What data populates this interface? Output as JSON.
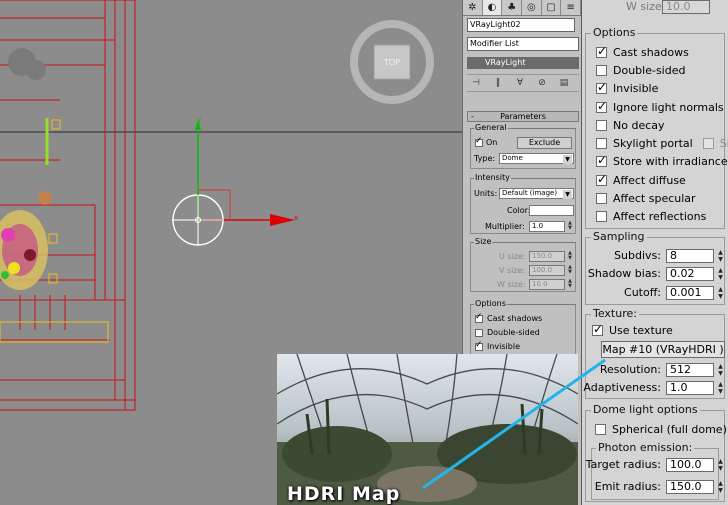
{
  "viewport": {
    "label": "TOP",
    "axis_x": "x",
    "axis_y": "y",
    "colors": {
      "bg": "#8c8c8c",
      "wire": "#cc1111",
      "selected": "#ffffff",
      "plant": "#d8c020"
    }
  },
  "command_panel": {
    "tabs": [
      "create-icon",
      "modify-icon",
      "hierarchy-icon",
      "motion-icon",
      "display-icon",
      "utilities-icon"
    ],
    "object_name": "VRayLight02",
    "modifier_list": "Modifier List",
    "stack_item": "VRayLight",
    "parameters_title": "Parameters",
    "general": {
      "label": "General",
      "on_label": "On",
      "on_checked": true,
      "exclude_button": "Exclude",
      "type_label": "Type:",
      "type_value": "Dome"
    },
    "intensity": {
      "label": "Intensity",
      "units_label": "Units:",
      "units_value": "Default (image)",
      "color_label": "Color:",
      "multiplier_label": "Multiplier:",
      "multiplier_value": "1.0"
    },
    "size": {
      "label": "Size",
      "u_label": "U size:",
      "u_value": "150.0",
      "v_label": "V size:",
      "v_value": "100.0",
      "w_label": "W size:",
      "w_value": "10.0"
    },
    "options": {
      "label": "Options",
      "items": [
        {
          "label": "Cast shadows",
          "checked": true
        },
        {
          "label": "Double-sided",
          "checked": false
        },
        {
          "label": "Invisible",
          "checked": true
        }
      ]
    }
  },
  "right_panel": {
    "w_size_label": "W size:",
    "w_size_value": "10.0",
    "options": {
      "label": "Options",
      "items": [
        {
          "label": "Cast shadows",
          "checked": true
        },
        {
          "label": "Double-sided",
          "checked": false
        },
        {
          "label": "Invisible",
          "checked": true
        },
        {
          "label": "Ignore light normals",
          "checked": true
        },
        {
          "label": "No decay",
          "checked": false
        },
        {
          "label": "Skylight portal",
          "checked": false
        },
        {
          "label": "Store with irradiance map",
          "checked": true
        },
        {
          "label": "Affect diffuse",
          "checked": true
        },
        {
          "label": "Affect specular",
          "checked": false
        },
        {
          "label": "Affect reflections",
          "checked": false
        }
      ],
      "simple_label": "Simple",
      "simple_checked": false
    },
    "sampling": {
      "label": "Sampling",
      "subdivs_label": "Subdivs:",
      "subdivs_value": "8",
      "shadow_bias_label": "Shadow bias:",
      "shadow_bias_value": "0.02",
      "cutoff_label": "Cutoff:",
      "cutoff_value": "0.001"
    },
    "texture": {
      "label": "Texture:",
      "use_texture_label": "Use texture",
      "use_texture_checked": true,
      "map_button": "Map #10  (VRayHDRI )",
      "resolution_label": "Resolution:",
      "resolution_value": "512",
      "adaptiveness_label": "Adaptiveness:",
      "adaptiveness_value": "1.0"
    },
    "dome": {
      "label": "Dome light options",
      "spherical_label": "Spherical (full dome)",
      "spherical_checked": false,
      "photon_label": "Photon emission:",
      "target_radius_label": "Target radius:",
      "target_radius_value": "100.0",
      "emit_radius_label": "Emit radius:",
      "emit_radius_value": "150.0"
    }
  },
  "hdri": {
    "label": "HDRI Map",
    "callout_color": "#22b6e8"
  }
}
